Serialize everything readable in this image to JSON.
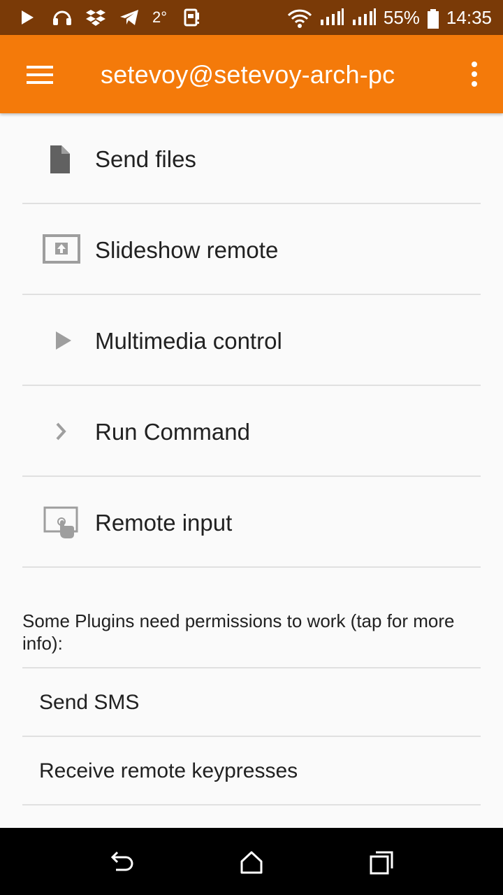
{
  "status_bar": {
    "temperature": "2°",
    "battery_percent": "55%",
    "time": "14:35",
    "icons": [
      "play-icon",
      "headset-icon",
      "dropbox-icon",
      "telegram-icon",
      "sim-icon",
      "wifi-icon",
      "signal-1-icon",
      "signal-2-icon",
      "battery-icon"
    ]
  },
  "app_bar": {
    "title": "setevoy@setevoy-arch-pc",
    "background": "#f47a0a"
  },
  "plugins": [
    {
      "label": "Send files",
      "icon": "file-icon"
    },
    {
      "label": "Slideshow remote",
      "icon": "presentation-icon"
    },
    {
      "label": "Multimedia control",
      "icon": "play-icon"
    },
    {
      "label": "Run Command",
      "icon": "chevron-right-icon"
    },
    {
      "label": "Remote input",
      "icon": "touchpad-icon"
    }
  ],
  "permissions": {
    "note": "Some Plugins need permissions to work (tap for more info):",
    "items": [
      {
        "label": "Send SMS"
      },
      {
        "label": "Receive remote keypresses"
      }
    ]
  },
  "nav_bar": {
    "icons": [
      "back-icon",
      "home-icon",
      "recents-icon"
    ]
  }
}
